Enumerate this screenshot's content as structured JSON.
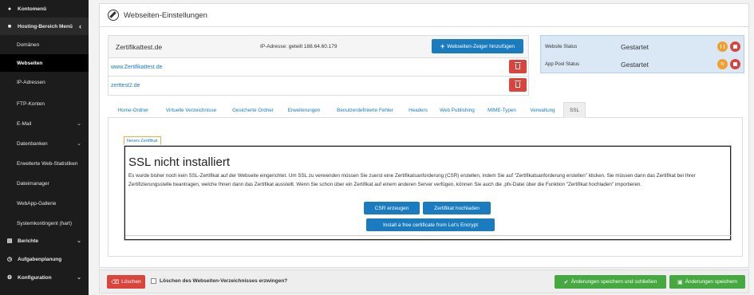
{
  "sidebar": {
    "items": [
      {
        "label": "Kontomenü",
        "icon": "user-icon"
      },
      {
        "label": "Hosting-Bereich Menü",
        "icon": "briefcase-icon"
      },
      {
        "label": "Domänen"
      },
      {
        "label": "Webseiten"
      },
      {
        "label": "IP-Adressen"
      },
      {
        "label": "FTP-Konten"
      },
      {
        "label": "E-Mail"
      },
      {
        "label": "Datenbanken"
      },
      {
        "label": "Erweiterte Web-Statistiken"
      },
      {
        "label": "Dateimanager"
      },
      {
        "label": "WebApp-Gallerie"
      },
      {
        "label": "Systemkontingent (hart)"
      },
      {
        "label": "Berichte",
        "icon": "bar-chart-icon"
      },
      {
        "label": "Aufgabenplanung",
        "icon": "clock-icon"
      },
      {
        "label": "Konfiguration",
        "icon": "cogs-icon"
      }
    ]
  },
  "header": {
    "title": "Webseiten-Einstellungen"
  },
  "domain": {
    "name": "Zertifikattest.de",
    "ip_label": "IP-Adresse:",
    "ip_value": "geteilt 188.64.60.179",
    "add_pointer_label": "Webseiten-Zeiger hinzufügen",
    "aliases": [
      "www.Zertifikattest.de",
      "zerttest2.de"
    ]
  },
  "status": {
    "website_label": "Website Status",
    "website_value": "Gestartet",
    "apppool_label": "App Pool Status",
    "apppool_value": "Gestartet"
  },
  "tabs": [
    "Home-Ordner",
    "Virtuelle Verzeichnisse",
    "Gesicherte Ordner",
    "Erweiterungen",
    "Benutzerdefinierte Fehler",
    "Headers",
    "Web Publishing",
    "MIME-Typen",
    "Verwaltung",
    "SSL"
  ],
  "active_tab": "SSL",
  "ssl": {
    "subtab": "Neues Zertifikat",
    "title": "SSL nicht installiert",
    "text": "Es wurde bisher noch kein SSL-Zertifikat auf der Webseite eingerichtet. Um SSL zu verwenden müssen Sie zuerst eine Zertifikatsanforderung (CSR) erstellen, indem Sie auf \"Zertifikatsanforderung erstellen\" klicken. Sie müssen dann das Zertifikat bei Ihrer Zertifizierungsstelle beantragen, welche Ihnen dann das Zertifikat ausstellt. Wenn Sie schon über ein Zertifikat auf einem anderen Server verfügen, können Sie auch die .pfx-Datei über die Funktion \"Zertifikat hochladen\" importieren.",
    "csr_button": "CSR erzeugen",
    "upload_button": "Zertifikat hochladen",
    "letsencrypt_button": "Install a free certificate from Let's Encrypt"
  },
  "footer": {
    "delete_label": "Löschen",
    "force_delete_label": "Löschen des Webseiten-Verzeichnisses erzwingen?",
    "save_close_label": "Änderungen speichern und schließen",
    "save_label": "Änderungen speichern"
  },
  "colors": {
    "primary": "#1b7bbf",
    "danger": "#d9453d",
    "success": "#46a840",
    "warning": "#f0a030",
    "sidebar": "#1c1c1c"
  }
}
